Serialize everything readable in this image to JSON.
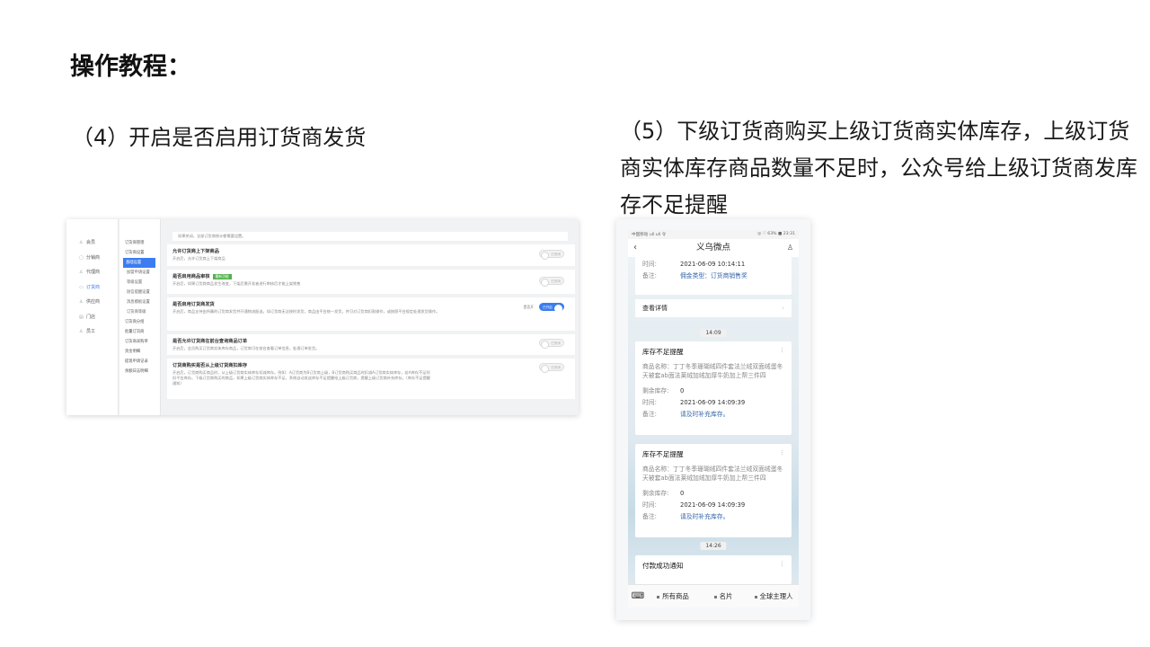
{
  "heading": "操作教程：",
  "step4": "（4）开启是否启用订货商发货",
  "step5": "（5）下级订货商购买上级订货商实体库存，上级订货商实体库存商品数量不足时，公众号给上级订货商发库存不足提醒",
  "admin": {
    "nav1": [
      "会员",
      "分销商",
      "代理商",
      "订货商",
      "供应商",
      "门店",
      "员工"
    ],
    "nav2": [
      "订货商管理",
      "订货商设置",
      "基础设置",
      "加盟申请设置",
      "等级设置",
      "短信提醒设置",
      "消息模板设置",
      "订货商等级",
      "订货商分组",
      "批量订货商",
      "订货商采购单",
      "资金明细",
      "提现申请记录",
      "余额日志明细"
    ],
    "top_text": "如果关闭，全部订货商统计都需要设置。",
    "cards": [
      {
        "title": "允许订货商上下架商品",
        "desc": "开启后，允许订货商上下架商品",
        "switch": "已关闭"
      },
      {
        "title": "是否启用商品审核",
        "tag": "最新功能",
        "desc": "开启后，如果订货商商品发生改变，下架后需开发者进行审核后才能上架销售",
        "switch": "已关闭"
      },
      {
        "title": "是否启用订货商发货",
        "desc": "开启后，商品支持由所属的订货商发货并开通物流配送。如订货商无法按时发货，商品由平台统一发货，并可对订货商扣款操作，或按照平台规定处理发货操作。",
        "switch": "已开启",
        "switch_text": "是否开"
      },
      {
        "title": "是否允许订货商在前台查询商品订单",
        "desc": "开启后，会员购买订货商实体库存商品，订货商可在前台查看订单信息，处理订单发货。",
        "switch": "已关闭"
      },
      {
        "title": "订货商购买是否从上级订货商扣库存",
        "desc": "开启后，订货商购买商品时，从上级订货商实体库存扣减库存。例如：A订货商为B订货商上级，B订货商购买商品时扣减A订货商实体库存，若A库存不足则扣平台库存。下级订货商购买的商品，如果上级订货商实体库存不足，系统自动发送库存不足提醒给上级订货商，提醒上级订货商补充库存。（库存不足提醒通知）",
        "switch": "已关闭"
      }
    ]
  },
  "phone": {
    "status_left": "中国移动 ull ull 令",
    "status_right": "◎ ♡ 63% ■ 23:31",
    "title": "义乌微点",
    "top_time_label": "时间:",
    "top_time": "2021-06-09 10:14:11",
    "top_note_label": "备注:",
    "top_note": "佣金类型：订货商销售奖",
    "detail": "查看详情",
    "chip1": "14:09",
    "messages": [
      {
        "title": "库存不足提醒",
        "body": "商品名称：丁丁冬季珊瑚绒四件套法兰绒双面绒蛋冬天被套ab面法莱绒加绒加厚牛奶加上帮三件四",
        "stock_label": "剩余库存:",
        "stock": "0",
        "time_label": "时间:",
        "time": "2021-06-09 14:09:39",
        "note_label": "备注:",
        "note": "请及时补充库存。"
      },
      {
        "title": "库存不足提醒",
        "body": "商品名称：丁丁冬季珊瑚绒四件套法兰绒双面绒蛋冬天被套ab面法莱绒加绒加厚牛奶加上帮三件四",
        "stock_label": "剩余库存:",
        "stock": "0",
        "time_label": "时间:",
        "time": "2021-06-09 14:09:39",
        "note_label": "备注:",
        "note": "请及时补充库存。"
      }
    ],
    "chip2": "14:26",
    "last_title": "付款成功通知",
    "bottom": [
      "所有商品",
      "名片",
      "全球主理人"
    ]
  }
}
